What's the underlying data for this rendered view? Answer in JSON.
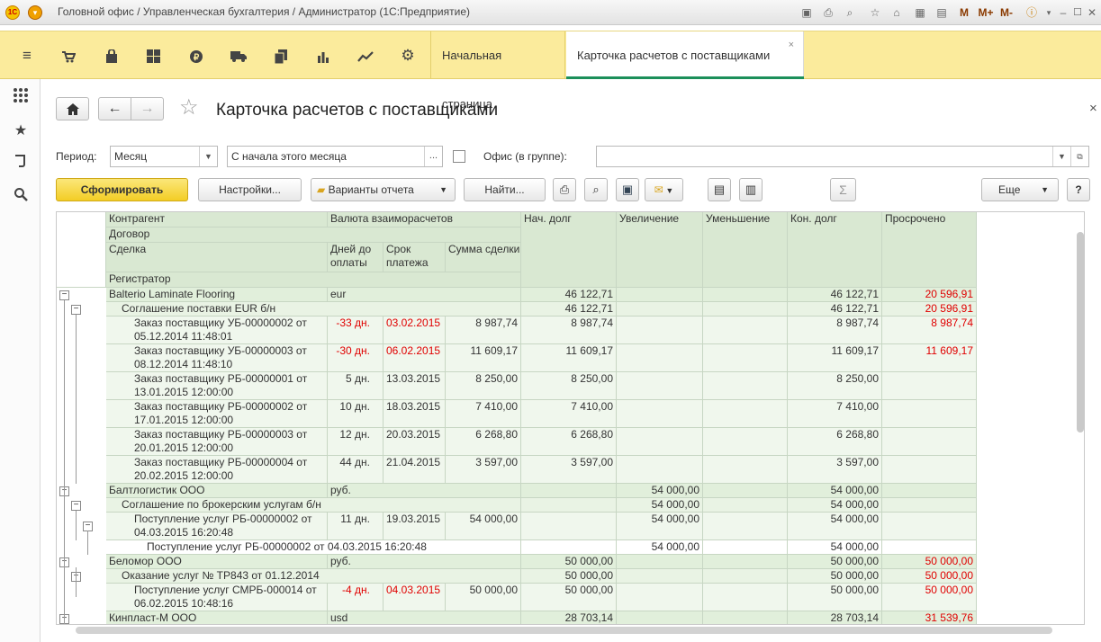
{
  "window": {
    "title": "Головной офис / Управленческая бухгалтерия / Администратор  (1С:Предприятие)"
  },
  "title_icons": {
    "m": "M",
    "mplus": "M+",
    "mminus": "M-"
  },
  "sections": [
    "menu-icon",
    "cart-icon",
    "bag-icon",
    "grid-icon",
    "ruble-icon",
    "truck-icon",
    "docs-icon",
    "bar-chart-icon",
    "trend-icon",
    "gear-icon"
  ],
  "tabs": {
    "home": "Начальная страница",
    "card": "Карточка расчетов с поставщиками",
    "close": "×"
  },
  "form": {
    "title": "Карточка расчетов с поставщиками",
    "close": "×",
    "star": "☆"
  },
  "filters": {
    "period_label": "Период:",
    "period_type": "Месяц",
    "period_value": "С начала этого месяца",
    "ellipsis": "...",
    "office_label": "Офис (в группе):",
    "office_value": ""
  },
  "buttons": {
    "generate": "Сформировать",
    "settings": "Настройки...",
    "variants": "Варианты отчета",
    "find": "Найти...",
    "more": "Еще",
    "help": "?",
    "sum": "Σ"
  },
  "headers": {
    "contractor": "Контрагент",
    "currency": "Валюта взаиморасчетов",
    "contract": "Договор",
    "deal": "Сделка",
    "days": "Дней до оплаты",
    "term": "Срок платежа",
    "deal_sum": "Сумма сделки",
    "registrar": "Регистратор",
    "start": "Нач. долг",
    "increase": "Увеличение",
    "decrease": "Уменьшение",
    "end": "Кон. долг",
    "overdue": "Просрочено"
  },
  "rows": [
    {
      "lvl": 1,
      "toggle": "−",
      "name": "Balterio Laminate Flooring",
      "cur": "eur",
      "start": "46 122,71",
      "inc": "",
      "dec": "",
      "end": "46 122,71",
      "ovd": "20 596,91"
    },
    {
      "lvl": 2,
      "toggle": "−",
      "name": "Соглашение поставки EUR б/н",
      "start": "46 122,71",
      "inc": "",
      "dec": "",
      "end": "46 122,71",
      "ovd": "20 596,91"
    },
    {
      "lvl": 3,
      "name": "Заказ поставщику УБ-00000002 от\n05.12.2014 11:48:01",
      "days": "-33 дн.",
      "term": "03.02.2015",
      "sum": "8 987,74",
      "red": true,
      "start": "8 987,74",
      "inc": "",
      "dec": "",
      "end": "8 987,74",
      "ovd": "8 987,74"
    },
    {
      "lvl": 3,
      "name": "Заказ поставщику УБ-00000003 от\n08.12.2014 11:48:10",
      "days": "-30 дн.",
      "term": "06.02.2015",
      "sum": "11 609,17",
      "red": true,
      "start": "11 609,17",
      "inc": "",
      "dec": "",
      "end": "11 609,17",
      "ovd": "11 609,17"
    },
    {
      "lvl": 3,
      "name": "Заказ поставщику РБ-00000001 от\n13.01.2015 12:00:00",
      "days": "5 дн.",
      "term": "13.03.2015",
      "sum": "8 250,00",
      "start": "8 250,00",
      "inc": "",
      "dec": "",
      "end": "8 250,00",
      "ovd": ""
    },
    {
      "lvl": 3,
      "name": "Заказ поставщику РБ-00000002 от\n17.01.2015 12:00:00",
      "days": "10 дн.",
      "term": "18.03.2015",
      "sum": "7 410,00",
      "start": "7 410,00",
      "inc": "",
      "dec": "",
      "end": "7 410,00",
      "ovd": ""
    },
    {
      "lvl": 3,
      "name": "Заказ поставщику РБ-00000003 от\n20.01.2015 12:00:00",
      "days": "12 дн.",
      "term": "20.03.2015",
      "sum": "6 268,80",
      "start": "6 268,80",
      "inc": "",
      "dec": "",
      "end": "6 268,80",
      "ovd": ""
    },
    {
      "lvl": 3,
      "name": "Заказ поставщику РБ-00000004 от\n20.02.2015 12:00:00",
      "days": "44 дн.",
      "term": "21.04.2015",
      "sum": "3 597,00",
      "start": "3 597,00",
      "inc": "",
      "dec": "",
      "end": "3 597,00",
      "ovd": ""
    },
    {
      "lvl": 1,
      "toggle": "−",
      "name": "Балтлогистик ООО",
      "cur": "руб.",
      "start": "",
      "inc": "54 000,00",
      "dec": "",
      "end": "54 000,00",
      "ovd": ""
    },
    {
      "lvl": 2,
      "toggle": "−",
      "name": "Соглашение по брокерским услугам б/н",
      "start": "",
      "inc": "54 000,00",
      "dec": "",
      "end": "54 000,00",
      "ovd": ""
    },
    {
      "lvl": 3,
      "toggle": "−",
      "name": "Поступление услуг РБ-00000002 от\n04.03.2015 16:20:48",
      "days": "11 дн.",
      "term": "19.03.2015",
      "sum": "54 000,00",
      "start": "",
      "inc": "54 000,00",
      "dec": "",
      "end": "54 000,00",
      "ovd": ""
    },
    {
      "lvl": 4,
      "name": "Поступление услуг РБ-00000002 от 04.03.2015 16:20:48",
      "start": "",
      "inc": "54 000,00",
      "dec": "",
      "end": "54 000,00",
      "ovd": ""
    },
    {
      "lvl": 1,
      "toggle": "−",
      "name": "Беломор ООО",
      "cur": "руб.",
      "start": "50 000,00",
      "inc": "",
      "dec": "",
      "end": "50 000,00",
      "ovd": "50 000,00"
    },
    {
      "lvl": 2,
      "toggle": "−",
      "name": "Оказание услуг № ТР843 от 01.12.2014",
      "start": "50 000,00",
      "inc": "",
      "dec": "",
      "end": "50 000,00",
      "ovd": "50 000,00"
    },
    {
      "lvl": 3,
      "name": "Поступление услуг СМРБ-000014 от\n06.02.2015 10:48:16",
      "days": "-4 дн.",
      "term": "04.03.2015",
      "sum": "50 000,00",
      "red": true,
      "start": "50 000,00",
      "inc": "",
      "dec": "",
      "end": "50 000,00",
      "ovd": "50 000,00"
    },
    {
      "lvl": 1,
      "toggle": "−",
      "name": "Кинпласт-М ООО",
      "cur": "usd",
      "start": "28 703,14",
      "inc": "",
      "dec": "",
      "end": "28 703,14",
      "ovd": "31 539,76"
    }
  ]
}
